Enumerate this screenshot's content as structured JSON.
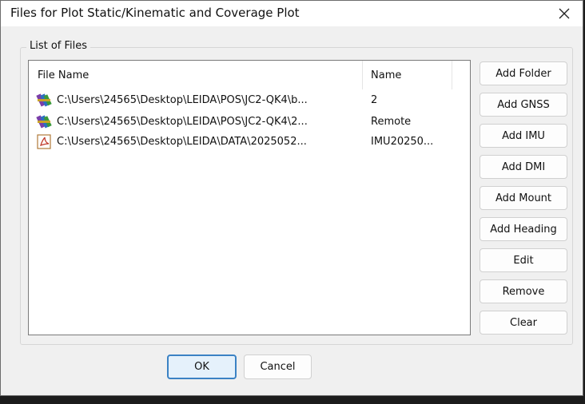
{
  "window": {
    "title": "Files for Plot Static/Kinematic and Coverage Plot"
  },
  "group": {
    "label": "List of Files"
  },
  "list": {
    "columns": {
      "file_name": "File Name",
      "name": "Name"
    },
    "rows": [
      {
        "icon": "winrar-archive-icon",
        "path": "C:\\Users\\24565\\Desktop\\LEIDA\\POS\\JC2-QK4\\b...",
        "name": "2"
      },
      {
        "icon": "winrar-archive-icon",
        "path": "C:\\Users\\24565\\Desktop\\LEIDA\\POS\\JC2-QK4\\2...",
        "name": "Remote"
      },
      {
        "icon": "pdf-document-icon",
        "path": "C:\\Users\\24565\\Desktop\\LEIDA\\DATA\\2025052...",
        "name": "IMU20250..."
      }
    ]
  },
  "buttons": {
    "add_folder": "Add Folder",
    "add_gnss": "Add GNSS",
    "add_imu": "Add IMU",
    "add_dmi": "Add DMI",
    "add_mount": "Add Mount",
    "add_heading": "Add Heading",
    "edit": "Edit",
    "remove": "Remove",
    "clear": "Clear",
    "ok": "OK",
    "cancel": "Cancel"
  },
  "colors": {
    "dialog_bg": "#f0f0f0",
    "default_button_border": "#3b82c4"
  }
}
